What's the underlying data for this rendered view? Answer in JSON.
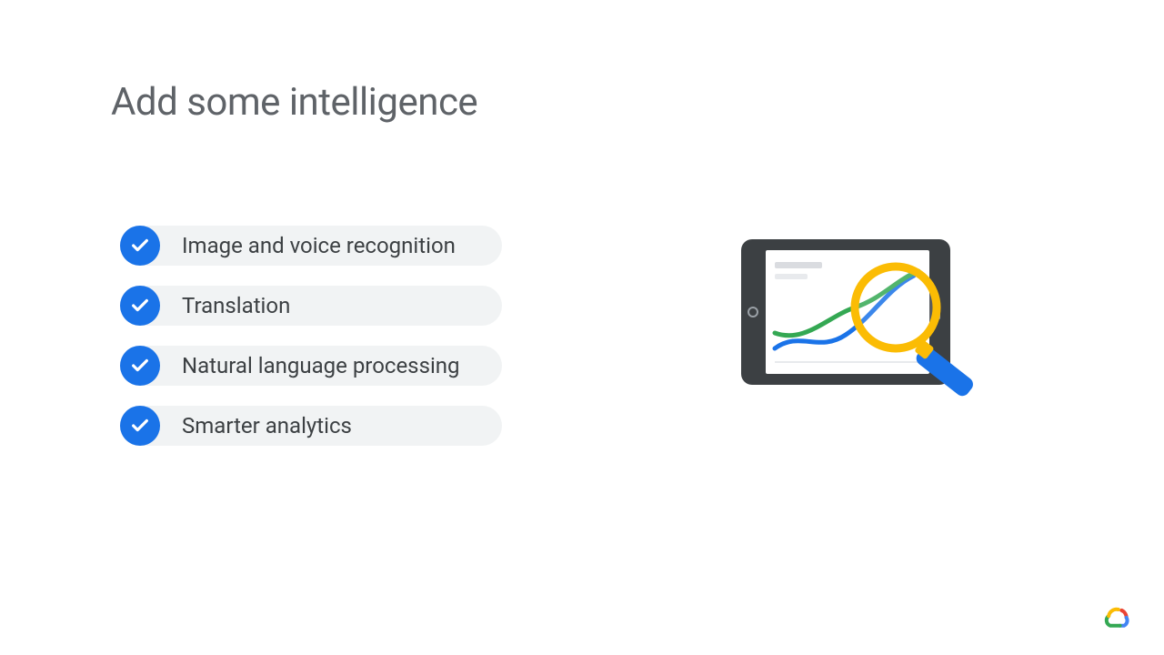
{
  "title": "Add some intelligence",
  "features": [
    {
      "label": "Image and voice recognition"
    },
    {
      "label": "Translation"
    },
    {
      "label": "Natural language processing"
    },
    {
      "label": "Smarter analytics"
    }
  ],
  "colors": {
    "accent": "#1a73e8",
    "title": "#5f6368",
    "pill_bg": "#f1f3f4",
    "text": "#3c4043"
  }
}
